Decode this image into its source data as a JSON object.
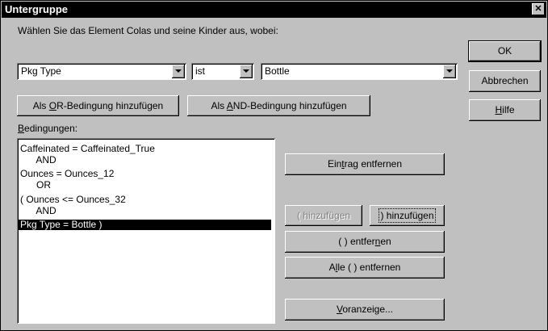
{
  "dialog": {
    "title": "Untergruppe",
    "close_glyph": "✕",
    "instruction": "Wählen Sie das Element Colas und seine Kinder aus, wobei:",
    "field_combo": {
      "value": "Pkg Type"
    },
    "operator_combo": {
      "value": "ist"
    },
    "value_combo": {
      "value": "Bottle"
    },
    "or_button": {
      "pre": "Als ",
      "mnemonic": "O",
      "post": "R-Bedingung hinzufügen"
    },
    "and_button": {
      "pre": "Als ",
      "mnemonic": "A",
      "post": "ND-Bedingung hinzufügen"
    },
    "conditions_label": {
      "mnemonic": "B",
      "rest": "edingungen:"
    },
    "conditions": [
      {
        "text": "Caffeinated = Caffeinated_True",
        "selected": false
      },
      {
        "text": "      AND",
        "selected": false
      },
      {
        "text": "Ounces = Ounces_12",
        "selected": false
      },
      {
        "text": "      OR",
        "selected": false
      },
      {
        "text": "( Ounces <= Ounces_32",
        "selected": false
      },
      {
        "text": "      AND",
        "selected": false
      },
      {
        "text": "Pkg Type = Bottle )",
        "selected": true
      }
    ],
    "remove_entry_button": {
      "pre": "Ein",
      "mnemonic": "t",
      "post": "rag entfernen"
    },
    "add_paren_disabled_button": {
      "label": "( hinzufügen"
    },
    "add_paren_close_button": {
      "label": ") hinzufügen"
    },
    "remove_parens_button": {
      "pre": "(   ) entfer",
      "mnemonic": "n",
      "post": "en"
    },
    "remove_all_parens_button": {
      "pre": "A",
      "mnemonic": "l",
      "post": "le (   ) entfernen"
    },
    "preview_button": {
      "pre": "",
      "mnemonic": "V",
      "post": "oranzeige..."
    },
    "ok_button": {
      "label": "OK"
    },
    "cancel_button": {
      "label": "Abbrechen"
    },
    "help_button": {
      "pre": "",
      "mnemonic": "H",
      "post": "ilfe"
    }
  }
}
